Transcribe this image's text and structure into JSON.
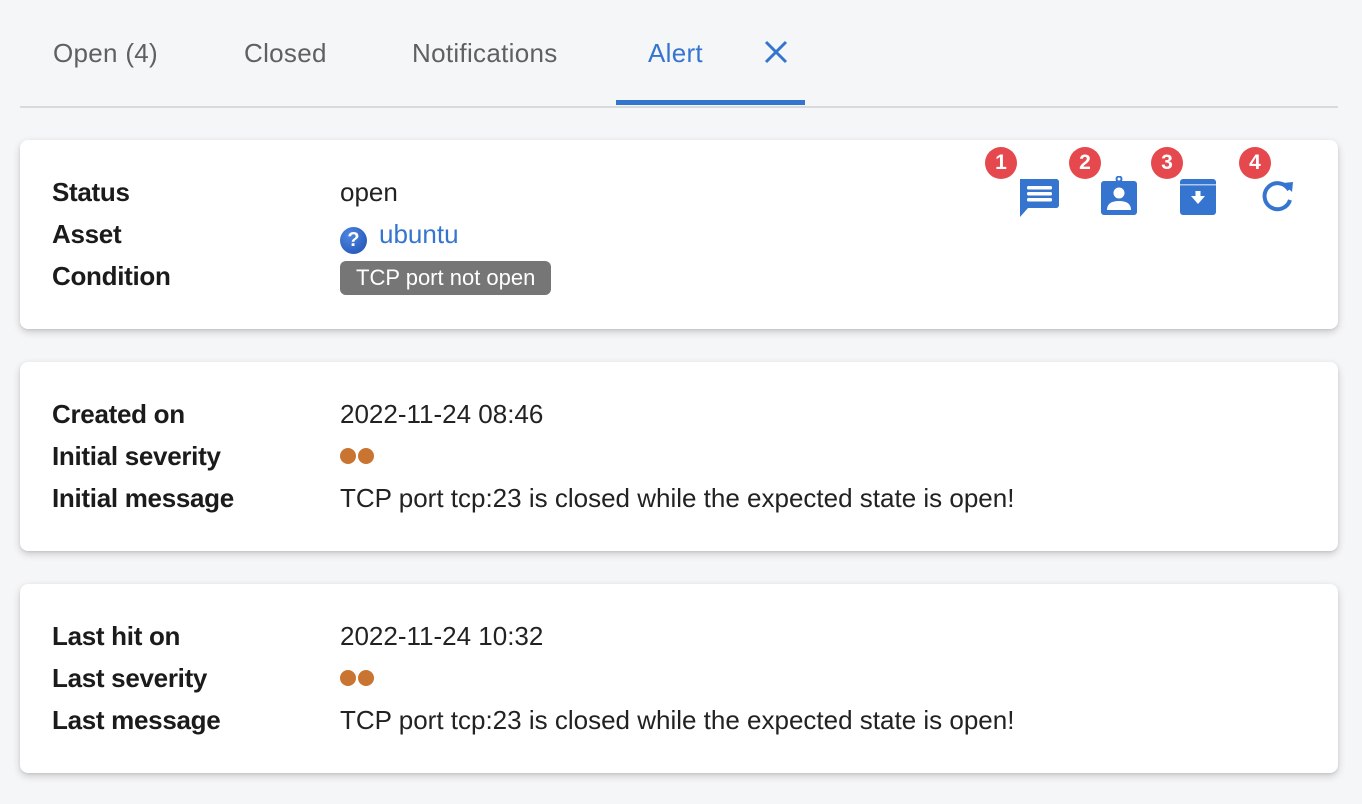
{
  "tabs": [
    {
      "label": "Open (4)",
      "active": false
    },
    {
      "label": "Closed",
      "active": false
    },
    {
      "label": "Notifications",
      "active": false
    },
    {
      "label": "Alert",
      "active": true
    }
  ],
  "colors": {
    "accent": "#3575cf",
    "badge_bg": "#767676",
    "severity_dot": "#c97531",
    "step_marker": "#e5484d"
  },
  "summary": {
    "status_label": "Status",
    "status_value": "open",
    "asset_label": "Asset",
    "asset_icon": "question-circle-icon",
    "asset_value": "ubuntu",
    "condition_label": "Condition",
    "condition_value": "TCP port not open"
  },
  "actions": [
    {
      "marker": "1",
      "icon": "comment-icon"
    },
    {
      "marker": "2",
      "icon": "assign-user-icon"
    },
    {
      "marker": "3",
      "icon": "archive-icon"
    },
    {
      "marker": "4",
      "icon": "refresh-icon"
    }
  ],
  "initial": {
    "created_label": "Created on",
    "created_value": "2022-11-24 08:46",
    "severity_label": "Initial severity",
    "severity_level": 2,
    "message_label": "Initial message",
    "message_value": "TCP port tcp:23 is closed while the expected state is open!"
  },
  "last": {
    "hit_label": "Last hit on",
    "hit_value": "2022-11-24 10:32",
    "severity_label": "Last severity",
    "severity_level": 2,
    "message_label": "Last message",
    "message_value": "TCP port tcp:23 is closed while the expected state is open!"
  }
}
